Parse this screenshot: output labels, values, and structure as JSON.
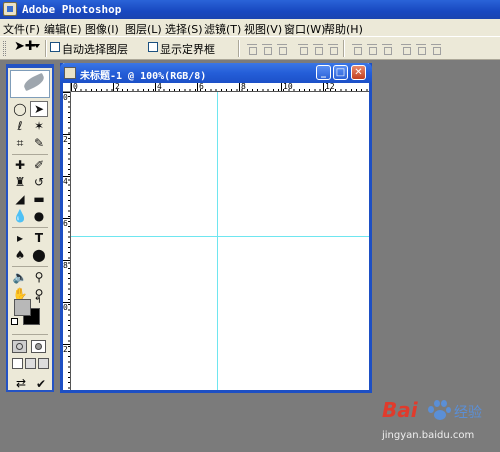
{
  "app": {
    "title": "Adobe Photoshop"
  },
  "menu": {
    "items": [
      {
        "label": "文件(F)"
      },
      {
        "label": "编辑(E)"
      },
      {
        "label": "图像(I)"
      },
      {
        "label": "图层(L)"
      },
      {
        "label": "选择(S)"
      },
      {
        "label": "滤镜(T)"
      },
      {
        "label": "视图(V)"
      },
      {
        "label": "窗口(W)"
      },
      {
        "label": "帮助(H)"
      }
    ]
  },
  "options": {
    "auto_select_label": "自动选择图层",
    "auto_select_checked": false,
    "show_bounds_label": "显示定界框",
    "show_bounds_checked": false
  },
  "toolbox": {
    "tools": [
      "marquee",
      "move",
      "lasso",
      "magic-wand",
      "crop",
      "slice",
      "healing-brush",
      "brush",
      "clone-stamp",
      "history-brush",
      "eraser",
      "gradient",
      "blur",
      "dodge",
      "path-selection",
      "type",
      "pen",
      "custom-shape",
      "notes",
      "eyedropper",
      "hand",
      "zoom"
    ],
    "active_tool": "move",
    "foreground_color": "#b8b8b8",
    "background_color": "#000000"
  },
  "document": {
    "title": "未标题-1 @ 100%(RGB/8)",
    "ruler_h_labels": [
      "0",
      "2",
      "4",
      "6",
      "8",
      "10",
      "12"
    ],
    "ruler_v_labels": [
      "0",
      "2",
      "4",
      "6",
      "8",
      "0",
      "2"
    ],
    "guide_color": "#6ee6f0"
  },
  "watermark": {
    "brand_left": "Bai",
    "brand_right": "经验",
    "url": "jingyan.baidu.com"
  }
}
